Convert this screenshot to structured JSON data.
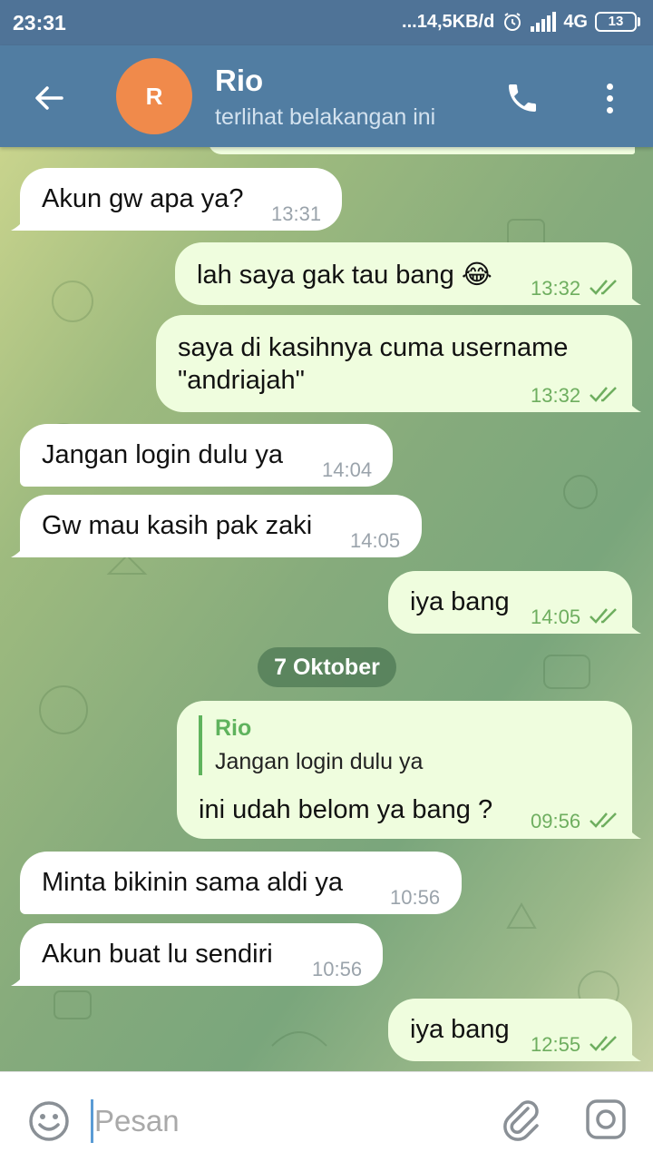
{
  "status_bar": {
    "time": "23:31",
    "network_speed": "...14,5KB/d",
    "network_type": "4G",
    "battery": "13"
  },
  "header": {
    "avatar_letter": "R",
    "contact_name": "Rio",
    "contact_status": "terlihat belakangan ini"
  },
  "messages": [
    {
      "direction": "in",
      "text": "Akun gw apa ya?",
      "time": "13:31"
    },
    {
      "direction": "out",
      "text": "lah saya gak tau bang 😂",
      "time": "13:32",
      "read": true
    },
    {
      "direction": "out",
      "text_lines": [
        "saya di kasihnya cuma username",
        "\"andriajah\""
      ],
      "time": "13:32",
      "read": true
    },
    {
      "direction": "in",
      "text": "Jangan login dulu ya",
      "time": "14:04"
    },
    {
      "direction": "in",
      "text": "Gw mau kasih pak zaki",
      "time": "14:05"
    },
    {
      "direction": "out",
      "text": "iya bang",
      "time": "14:05",
      "read": true
    },
    {
      "direction": "out",
      "reply_to": {
        "name": "Rio",
        "text": "Jangan login dulu ya"
      },
      "text": "ini udah belom ya bang ?",
      "time": "09:56",
      "read": true
    },
    {
      "direction": "in",
      "text": "Minta bikinin sama aldi ya",
      "time": "10:56"
    },
    {
      "direction": "in",
      "text": "Akun buat lu sendiri",
      "time": "10:56"
    },
    {
      "direction": "out",
      "text": "iya bang",
      "time": "12:55",
      "read": true
    }
  ],
  "date_separator": "7 Oktober",
  "input": {
    "placeholder": "Pesan"
  },
  "colors": {
    "header": "#517da2",
    "outgoing_bubble": "#effdde",
    "incoming_bubble": "#ffffff",
    "read_ticks": "#6eae5f",
    "avatar": "#f08a4b"
  }
}
